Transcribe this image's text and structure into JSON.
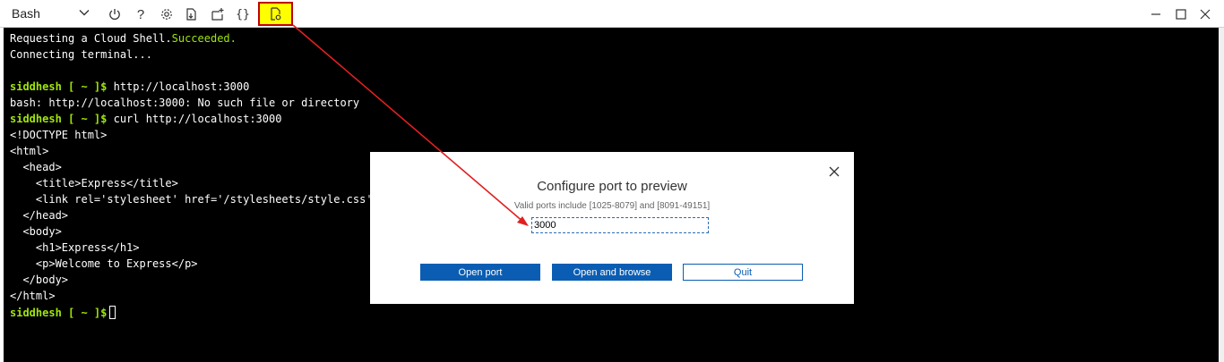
{
  "toolbar": {
    "shell_selector": "Bash",
    "icons": [
      "power-icon",
      "help-icon",
      "settings-icon",
      "upload-download-icon",
      "new-session-icon",
      "editor-braces-icon",
      "web-preview-icon"
    ],
    "help_glyph": "?",
    "braces_glyph": "{}"
  },
  "terminal": {
    "lines": {
      "l1_text": "Requesting a Cloud Shell.",
      "l1_status": "Succeeded.",
      "l2": "Connecting terminal...",
      "l4_prompt": "siddhesh [ ~ ]$",
      "l4_cmd": " http://localhost:3000",
      "l5": "bash: http://localhost:3000: No such file or directory",
      "l6_prompt": "siddhesh [ ~ ]$",
      "l6_cmd": " curl http://localhost:3000",
      "l7": "<!DOCTYPE html>",
      "l8": "<html>",
      "l9": "  <head>",
      "l10": "    <title>Express</title>",
      "l11": "    <link rel='stylesheet' href='/stylesheets/style.css' />",
      "l12": "  </head>",
      "l13": "  <body>",
      "l14": "    <h1>Express</h1>",
      "l15": "    <p>Welcome to Express</p>",
      "l16": "  </body>",
      "l17": "</html>",
      "l18_prompt": "siddhesh [ ~ ]$"
    }
  },
  "dialog": {
    "title": "Configure port to preview",
    "subtitle": "Valid ports include [1025-8079] and [8091-49151]",
    "port_value": "3000",
    "open_port_label": "Open port",
    "open_browse_label": "Open and browse",
    "quit_label": "Quit"
  },
  "colors": {
    "prompt_green": "#9fe60a",
    "button_blue": "#0a5db3",
    "highlight_yellow": "#ffff00",
    "annotation_red": "#e02020"
  }
}
